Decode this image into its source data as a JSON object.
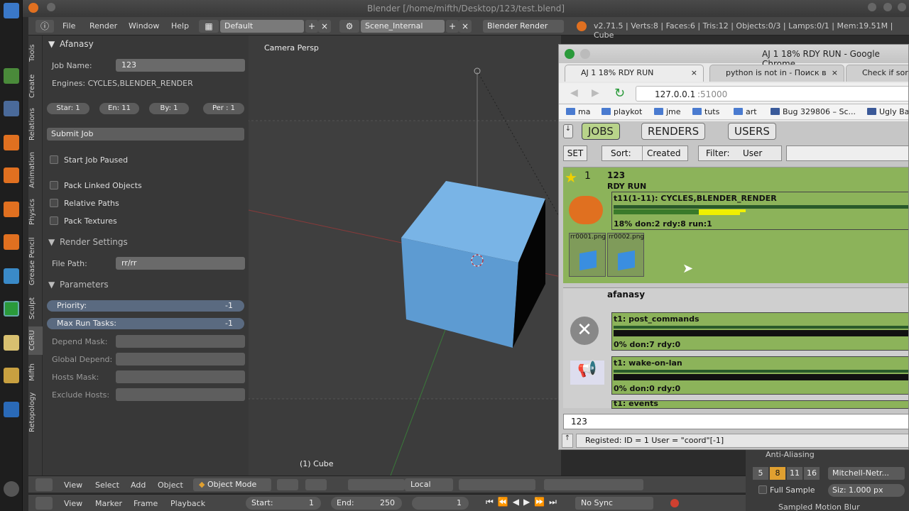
{
  "window_title": "Blender [/home/mifth/Desktop/123/test.blend]",
  "topbar": {
    "menus": [
      "File",
      "Render",
      "Window",
      "Help"
    ],
    "layout": "Default",
    "scene": "Scene_Internal",
    "engine": "Blender Render",
    "stats": "v2.71.5 | Verts:8 | Faces:6 | Tris:12 | Objects:0/3 | Lamps:0/1 | Mem:19.51M | Cube"
  },
  "vtabs": [
    "Tools",
    "Create",
    "Relations",
    "Animation",
    "Physics",
    "Grease Pencil",
    "Sculpt",
    "CGRU",
    "Mifth",
    "Retopology"
  ],
  "panel": {
    "header": "Afanasy",
    "job_name_label": "Job Name:",
    "job_name": "123",
    "engines": "Engines: CYCLES,BLENDER_RENDER",
    "start": "Star: 1",
    "end": "En: 11",
    "by": "By:   1",
    "per": "Per : 1",
    "submit": "Submit Job",
    "start_paused": "Start Job Paused",
    "pack_linked": "Pack Linked Objects",
    "relative_paths": "Relative Paths",
    "pack_textures": "Pack Textures",
    "render_settings": "Render Settings",
    "file_path_label": "File Path:",
    "file_path": "rr/rr",
    "parameters": "Parameters",
    "priority_label": "Priority:",
    "priority": "-1",
    "max_tasks_label": "Max Run Tasks:",
    "max_tasks": "-1",
    "depend_mask": "Depend Mask:",
    "global_depend": "Global Depend:",
    "hosts_mask": "Hosts Mask:",
    "exclude_hosts": "Exclude Hosts:"
  },
  "viewport": {
    "view_label": "Camera Persp",
    "object_label": "(1) Cube"
  },
  "browser": {
    "title": "AJ 1 18% RDY RUN - Google Chrome",
    "tabs": [
      "AJ 1 18% RDY RUN",
      "python is not in - Поиск в",
      "Check if sor"
    ],
    "url_host": "127.0.0.1",
    "url_port": ":51000",
    "bookmarks": [
      "ma",
      "playkot",
      "jme",
      "tuts",
      "art",
      "Bug 329806 – Sc...",
      "Ugly Ba"
    ],
    "nav": [
      "JOBS",
      "RENDERS",
      "USERS"
    ],
    "set": "SET",
    "sort_label": "Sort:",
    "sort_value": "Created",
    "filter_label": "Filter:",
    "filter_value": "User",
    "job": {
      "id": "1",
      "name": "123",
      "state": "RDY RUN",
      "block": "t11(1-11): CYCLES,BLENDER_RENDER",
      "progress_text": "18% don:2 rdy:8 run:1",
      "thumb1": "rr0001.png",
      "thumb2": "rr0002.png"
    },
    "job2": {
      "name": "afanasy",
      "task1": "t1: post_commands",
      "task1_progress": "0% don:7 rdy:0",
      "task2": "t1: wake-on-lan",
      "task2_progress": "0% don:0 rdy:0",
      "task3": "t1: events"
    },
    "console_input": "123",
    "status": "Registed: ID = 1 User = \"coord\"[-1]"
  },
  "bottom1": {
    "menus": [
      "View",
      "Select",
      "Add",
      "Object"
    ],
    "mode": "Object Mode",
    "orientation": "Local"
  },
  "bottom2": {
    "menus": [
      "View",
      "Marker",
      "Frame",
      "Playback"
    ],
    "start_label": "Start:",
    "start": "1",
    "end_label": "End:",
    "end": "250",
    "current": "1",
    "sync": "No Sync"
  },
  "rprops": {
    "section": "Anti-Aliasing",
    "samples": [
      "5",
      "8",
      "11",
      "16"
    ],
    "filter": "Mitchell-Netr...",
    "full_sample": "Full Sample",
    "size": "Siz: 1.000 px",
    "section2": "Sampled Motion Blur"
  },
  "colors": {
    "accent": "#5a6a80",
    "cgru_green": "#8cb35a",
    "progress_yellow": "#f0f000",
    "progress_green": "#3a7a2a"
  }
}
